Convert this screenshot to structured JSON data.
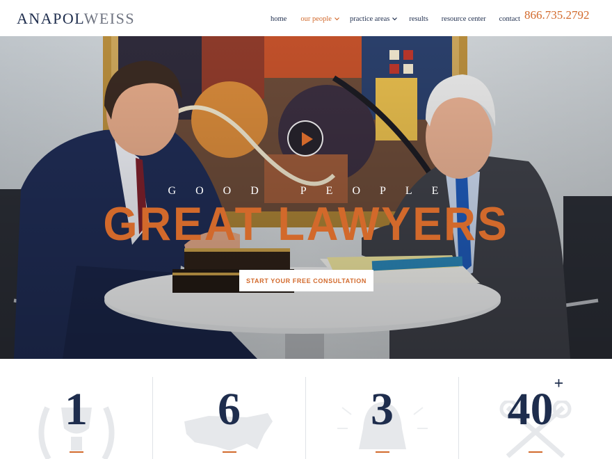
{
  "brand": {
    "part1": "ANAPOL",
    "part2": "WEISS"
  },
  "nav": {
    "items": [
      {
        "label": "home",
        "active": false,
        "dropdown": false
      },
      {
        "label": "our people",
        "active": true,
        "dropdown": true
      },
      {
        "label": "practice areas",
        "active": false,
        "dropdown": true
      },
      {
        "label": "results",
        "active": false,
        "dropdown": false
      },
      {
        "label": "resource center",
        "active": false,
        "dropdown": false
      },
      {
        "label": "contact",
        "active": false,
        "dropdown": false
      }
    ],
    "phone": "866.735.2792"
  },
  "hero": {
    "tagline": "GOOD PEOPLE",
    "headline": "GREAT LAWYERS",
    "cta_label": "START YOUR FREE CONSULTATION",
    "play_icon": "play-icon"
  },
  "stats": [
    {
      "value": "1",
      "suffix": "",
      "icon": "laurel-trophy-icon"
    },
    {
      "value": "6",
      "suffix": "",
      "icon": "us-map-icon"
    },
    {
      "value": "3",
      "suffix": "",
      "icon": "liberty-bell-icon"
    },
    {
      "value": "40",
      "suffix": "+",
      "icon": "crossed-keys-icon"
    }
  ],
  "colors": {
    "navy": "#1e2d4d",
    "accent": "#d2692b"
  }
}
